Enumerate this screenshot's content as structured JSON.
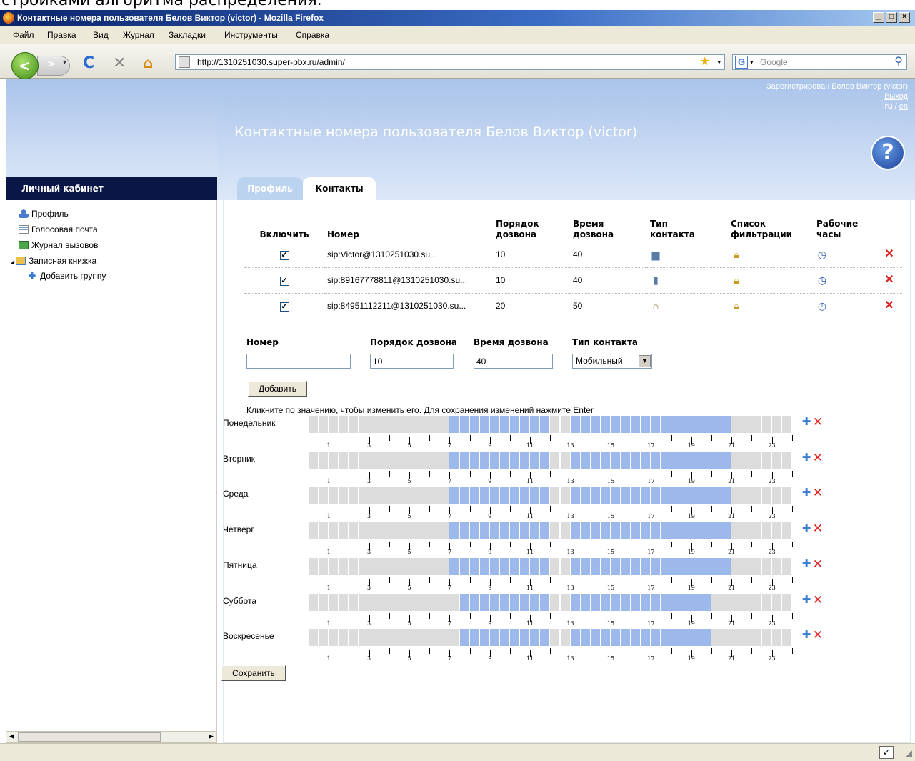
{
  "top_crop_text": "стройками алгоритма распределения.",
  "window": {
    "title": "Контактные номера пользователя Белов Виктор (victor) - Mozilla Firefox"
  },
  "menu": [
    "Файл",
    "Правка",
    "Вид",
    "Журнал",
    "Закладки",
    "Инструменты",
    "Справка"
  ],
  "address_bar": {
    "url": "http://1310251030.super-pbx.ru/admin/"
  },
  "search_bar": {
    "placeholder": "Google"
  },
  "header": {
    "page_title": "Контактные номера пользователя Белов Виктор (victor)",
    "registered": "Зарегистрирован Белов Виктор (victor)",
    "logout": "Выход",
    "lang_ru": "ru",
    "lang_sep": " / ",
    "lang_en": "en",
    "help": "?"
  },
  "sidebar": {
    "title": "Личный кабинет",
    "items": [
      {
        "label": "Профиль",
        "icon": "user-icon"
      },
      {
        "label": "Голосовая почта",
        "icon": "voicemail-icon"
      },
      {
        "label": "Журнал вызовов",
        "icon": "call-log-icon"
      },
      {
        "label": "Записная книжка",
        "icon": "address-book-icon"
      },
      {
        "label": "Добавить группу",
        "icon": "add-group-icon"
      }
    ]
  },
  "tabs": [
    {
      "label": "Профиль",
      "active": false
    },
    {
      "label": "Контакты",
      "active": true
    }
  ],
  "contacts_table": {
    "headers": [
      "Включить",
      "Номер",
      "Порядок дозвона",
      "Время дозвона",
      "Тип контакта",
      "Список фильтрации",
      "Рабочие часы"
    ],
    "header_lines": [
      [
        "Включить"
      ],
      [
        "Номер"
      ],
      [
        "Порядок",
        "дозвона"
      ],
      [
        "Время",
        "дозвона"
      ],
      [
        "Тип",
        "контакта"
      ],
      [
        "Список",
        "фильтрации"
      ],
      [
        "Рабочие",
        "часы"
      ]
    ],
    "rows": [
      {
        "enabled": true,
        "number": "sip:Victor@1310251030.su...",
        "order": "10",
        "time": "40",
        "type_icon": "computer-icon"
      },
      {
        "enabled": true,
        "number": "sip:89167778811@1310251030.su...",
        "order": "10",
        "time": "40",
        "type_icon": "mobile-phone-icon"
      },
      {
        "enabled": true,
        "number": "sip:84951112211@1310251030.su...",
        "order": "20",
        "time": "50",
        "type_icon": "home-icon"
      }
    ],
    "filter_icon": "lock-icon",
    "hours_icon": "clock-icon",
    "delete_icon": "delete-icon"
  },
  "add_form": {
    "number_label": "Номер",
    "number_value": "",
    "order_label": "Порядок дозвона",
    "order_value": "10",
    "time_label": "Время дозвона",
    "time_value": "40",
    "type_label": "Тип контакта",
    "type_value": "Мобильный",
    "add_button": "Добавить"
  },
  "schedule": {
    "hint": "Кликните по значению, чтобы изменить его. Для сохранения изменений нажмите Enter",
    "hour_labels": [
      "1",
      "3",
      "5",
      "7",
      "9",
      "11",
      "13",
      "15",
      "17",
      "19",
      "21",
      "23"
    ],
    "days": [
      {
        "name": "Понедельник",
        "active": [
          [
            7,
            12
          ],
          [
            13,
            21
          ]
        ]
      },
      {
        "name": "Вторник",
        "active": [
          [
            7,
            12
          ],
          [
            13,
            21
          ]
        ]
      },
      {
        "name": "Среда",
        "active": [
          [
            7,
            12
          ],
          [
            13,
            21
          ]
        ]
      },
      {
        "name": "Четверг",
        "active": [
          [
            7,
            12
          ],
          [
            13,
            21
          ]
        ]
      },
      {
        "name": "Пятница",
        "active": [
          [
            7,
            12
          ],
          [
            13,
            21
          ]
        ]
      },
      {
        "name": "Суббота",
        "active": [
          [
            7.5,
            12
          ],
          [
            13,
            20
          ]
        ]
      },
      {
        "name": "Воскресенье",
        "active": [
          [
            7.5,
            12
          ],
          [
            13,
            20
          ]
        ]
      }
    ],
    "save_button": "Сохранить"
  },
  "colors": {
    "active_slot": "#9db8ea",
    "inactive_slot": "#dcdcdc",
    "sidebar_title_bg": "#0a1746"
  }
}
